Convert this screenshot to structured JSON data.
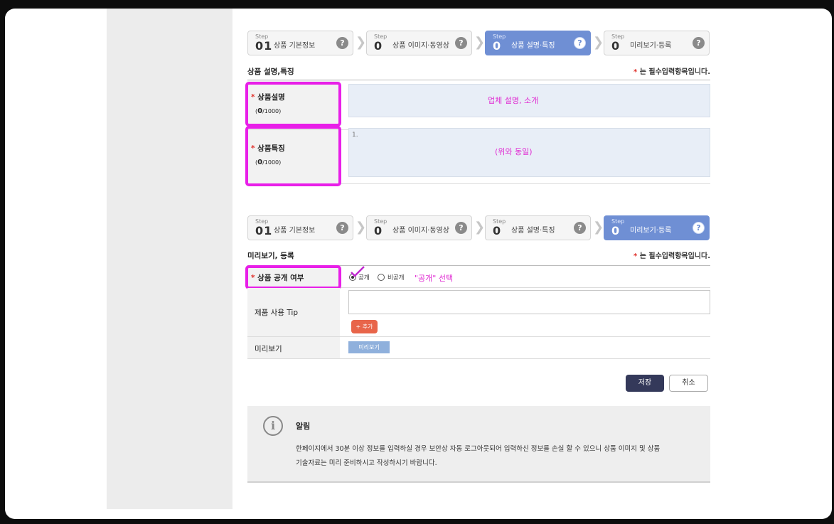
{
  "step_words": [
    "Step",
    "Step",
    "Step",
    "Step"
  ],
  "section1": {
    "steps": [
      {
        "num": "01",
        "label": "상품 기본정보"
      },
      {
        "num": "0",
        "label": "상품 이미지·동영상"
      },
      {
        "num": "0",
        "label": "상품 설명·특징"
      },
      {
        "num": "0",
        "label": "미리보기·등록"
      }
    ],
    "active_step": 3,
    "title": "상품 설명,특징",
    "required_note": "는 필수입력항목입니다.",
    "fields": {
      "description": {
        "label": "상품설명",
        "count_current": "0",
        "count_max": "/1000",
        "annotation": "업체 설명, 소개"
      },
      "features": {
        "label": "상품특징",
        "count_current": "0",
        "count_max": "/1000",
        "placeholder": "1.",
        "annotation": "(위와 동일)"
      }
    }
  },
  "section2": {
    "steps": [
      {
        "num": "01",
        "label": "상품 기본정보"
      },
      {
        "num": "0",
        "label": "상품 이미지·동영상"
      },
      {
        "num": "0",
        "label": "상품 설명·특징"
      },
      {
        "num": "0",
        "label": "미리보기·등록"
      }
    ],
    "active_step": 4,
    "title": "미리보기, 등록",
    "required_note": "는 필수입력항목입니다.",
    "visibility": {
      "label": "상품 공개 여부",
      "option_public": "공개",
      "option_private": "비공개",
      "annotation": "\"공개\" 선택"
    },
    "tip": {
      "label": "제품 사용 Tip",
      "add_label": "+ 추가"
    },
    "preview": {
      "label": "미리보기",
      "button_label": "미리보기"
    }
  },
  "actions": {
    "save_label": "저장",
    "cancel_label": "취소"
  },
  "notice": {
    "title": "알림",
    "line1": "한페이지에서 30분 이상 정보를 입력하실 경우 보안상 자동 로그아웃되어 입력하신 정보를 손실 할 수 있으니 상품 이미지 및 상품",
    "line2": "기술자료는 미리 준비하시고 작성하시기 바랍니다.",
    "icon": "info-icon"
  },
  "colors": {
    "highlight": "#e81fe8",
    "active_step": "#6f8fd4",
    "required_star": "#e0302a",
    "save_button": "#34395a"
  }
}
